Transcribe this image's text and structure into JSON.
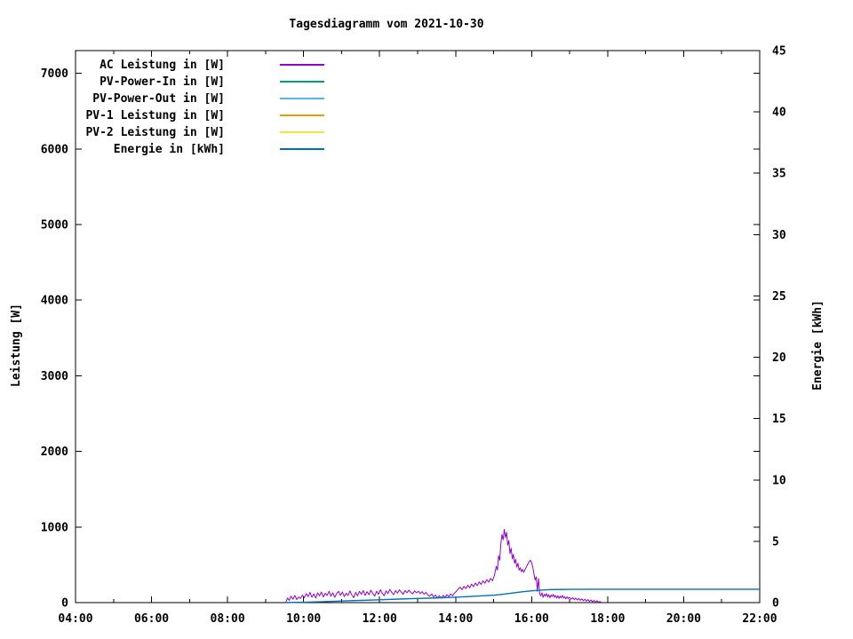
{
  "chart_data": {
    "type": "line",
    "title": "Tagesdiagramm vom 2021-10-30",
    "xlabel": "",
    "ylabel": "Leistung [W]",
    "y2label": "Energie [kWh]",
    "xlim_hours": [
      4,
      22
    ],
    "ylim": [
      0,
      7300
    ],
    "y2lim": [
      0,
      45
    ],
    "grid": false,
    "background": "#ffffff",
    "border_color": "#000000",
    "legend_position": "top-left-inside",
    "x_ticks": [
      {
        "v": 4,
        "label": "04:00"
      },
      {
        "v": 6,
        "label": "06:00"
      },
      {
        "v": 8,
        "label": "08:00"
      },
      {
        "v": 10,
        "label": "10:00"
      },
      {
        "v": 12,
        "label": "12:00"
      },
      {
        "v": 14,
        "label": "14:00"
      },
      {
        "v": 16,
        "label": "16:00"
      },
      {
        "v": 18,
        "label": "18:00"
      },
      {
        "v": 20,
        "label": "20:00"
      },
      {
        "v": 22,
        "label": "22:00"
      }
    ],
    "x_minor_ticks": [
      5,
      7,
      9,
      11,
      13,
      15,
      17,
      19,
      21
    ],
    "y_ticks": [
      {
        "v": 0,
        "label": "0"
      },
      {
        "v": 1000,
        "label": "1000"
      },
      {
        "v": 2000,
        "label": "2000"
      },
      {
        "v": 3000,
        "label": "3000"
      },
      {
        "v": 4000,
        "label": "4000"
      },
      {
        "v": 5000,
        "label": "5000"
      },
      {
        "v": 6000,
        "label": "6000"
      },
      {
        "v": 7000,
        "label": "7000"
      }
    ],
    "y2_ticks": [
      {
        "v": 0,
        "label": "0"
      },
      {
        "v": 5,
        "label": "5"
      },
      {
        "v": 10,
        "label": "10"
      },
      {
        "v": 15,
        "label": "15"
      },
      {
        "v": 20,
        "label": "20"
      },
      {
        "v": 25,
        "label": "25"
      },
      {
        "v": 30,
        "label": "30"
      },
      {
        "v": 35,
        "label": "35"
      },
      {
        "v": 40,
        "label": "40"
      },
      {
        "v": 45,
        "label": "45"
      }
    ],
    "series": [
      {
        "name": "AC Leistung in [W]",
        "color": "#9400d3",
        "axis": "y",
        "width": 1,
        "points": [
          [
            9.53,
            5
          ],
          [
            9.58,
            60
          ],
          [
            9.62,
            30
          ],
          [
            9.67,
            85
          ],
          [
            9.72,
            45
          ],
          [
            9.77,
            95
          ],
          [
            9.82,
            40
          ],
          [
            9.87,
            75
          ],
          [
            9.92,
            55
          ],
          [
            9.97,
            100
          ],
          [
            10.02,
            65
          ],
          [
            10.07,
            120
          ],
          [
            10.12,
            80
          ],
          [
            10.17,
            135
          ],
          [
            10.22,
            70
          ],
          [
            10.27,
            115
          ],
          [
            10.32,
            60
          ],
          [
            10.37,
            130
          ],
          [
            10.42,
            90
          ],
          [
            10.47,
            140
          ],
          [
            10.52,
            75
          ],
          [
            10.57,
            125
          ],
          [
            10.62,
            95
          ],
          [
            10.67,
            150
          ],
          [
            10.72,
            85
          ],
          [
            10.77,
            130
          ],
          [
            10.82,
            70
          ],
          [
            10.87,
            120
          ],
          [
            10.92,
            150
          ],
          [
            10.97,
            95
          ],
          [
            11.02,
            140
          ],
          [
            11.07,
            80
          ],
          [
            11.12,
            125
          ],
          [
            11.17,
            95
          ],
          [
            11.22,
            155
          ],
          [
            11.27,
            100
          ],
          [
            11.32,
            65
          ],
          [
            11.37,
            135
          ],
          [
            11.42,
            90
          ],
          [
            11.47,
            150
          ],
          [
            11.52,
            110
          ],
          [
            11.57,
            160
          ],
          [
            11.62,
            95
          ],
          [
            11.67,
            145
          ],
          [
            11.72,
            105
          ],
          [
            11.77,
            165
          ],
          [
            11.82,
            120
          ],
          [
            11.87,
            85
          ],
          [
            11.92,
            150
          ],
          [
            11.97,
            110
          ],
          [
            12.02,
            170
          ],
          [
            12.07,
            125
          ],
          [
            12.12,
            90
          ],
          [
            12.17,
            155
          ],
          [
            12.22,
            120
          ],
          [
            12.27,
            175
          ],
          [
            12.32,
            135
          ],
          [
            12.37,
            105
          ],
          [
            12.42,
            160
          ],
          [
            12.47,
            125
          ],
          [
            12.52,
            170
          ],
          [
            12.57,
            140
          ],
          [
            12.62,
            110
          ],
          [
            12.67,
            160
          ],
          [
            12.72,
            130
          ],
          [
            12.77,
            165
          ],
          [
            12.82,
            135
          ],
          [
            12.87,
            115
          ],
          [
            12.92,
            155
          ],
          [
            12.97,
            130
          ],
          [
            13.02,
            150
          ],
          [
            13.07,
            120
          ],
          [
            13.12,
            145
          ],
          [
            13.17,
            110
          ],
          [
            13.22,
            135
          ],
          [
            13.27,
            100
          ],
          [
            13.32,
            85
          ],
          [
            13.37,
            115
          ],
          [
            13.42,
            75
          ],
          [
            13.47,
            100
          ],
          [
            13.52,
            65
          ],
          [
            13.57,
            90
          ],
          [
            13.62,
            60
          ],
          [
            13.67,
            95
          ],
          [
            13.72,
            70
          ],
          [
            13.77,
            105
          ],
          [
            13.82,
            80
          ],
          [
            13.87,
            115
          ],
          [
            13.92,
            90
          ],
          [
            13.97,
            125
          ],
          [
            14.02,
            150
          ],
          [
            14.07,
            180
          ],
          [
            14.12,
            205
          ],
          [
            14.17,
            170
          ],
          [
            14.22,
            215
          ],
          [
            14.27,
            185
          ],
          [
            14.32,
            230
          ],
          [
            14.37,
            195
          ],
          [
            14.42,
            245
          ],
          [
            14.47,
            210
          ],
          [
            14.52,
            260
          ],
          [
            14.57,
            225
          ],
          [
            14.62,
            275
          ],
          [
            14.67,
            240
          ],
          [
            14.72,
            290
          ],
          [
            14.77,
            255
          ],
          [
            14.82,
            305
          ],
          [
            14.87,
            270
          ],
          [
            14.92,
            320
          ],
          [
            14.97,
            290
          ],
          [
            15.02,
            360
          ],
          [
            15.07,
            480
          ],
          [
            15.1,
            430
          ],
          [
            15.13,
            620
          ],
          [
            15.16,
            560
          ],
          [
            15.19,
            780
          ],
          [
            15.22,
            900
          ],
          [
            15.25,
            830
          ],
          [
            15.28,
            970
          ],
          [
            15.31,
            860
          ],
          [
            15.34,
            930
          ],
          [
            15.37,
            760
          ],
          [
            15.4,
            820
          ],
          [
            15.43,
            650
          ],
          [
            15.46,
            720
          ],
          [
            15.49,
            580
          ],
          [
            15.52,
            640
          ],
          [
            15.55,
            520
          ],
          [
            15.58,
            570
          ],
          [
            15.61,
            470
          ],
          [
            15.64,
            520
          ],
          [
            15.67,
            430
          ],
          [
            15.7,
            460
          ],
          [
            15.73,
            410
          ],
          [
            15.76,
            440
          ],
          [
            15.79,
            400
          ],
          [
            15.82,
            430
          ],
          [
            15.85,
            460
          ],
          [
            15.88,
            490
          ],
          [
            15.91,
            520
          ],
          [
            15.94,
            545
          ],
          [
            15.97,
            560
          ],
          [
            16.0,
            530
          ],
          [
            16.03,
            470
          ],
          [
            16.06,
            380
          ],
          [
            16.09,
            300
          ],
          [
            16.12,
            340
          ],
          [
            16.15,
            150
          ],
          [
            16.18,
            320
          ],
          [
            16.21,
            120
          ],
          [
            16.24,
            90
          ],
          [
            16.27,
            130
          ],
          [
            16.3,
            70
          ],
          [
            16.33,
            110
          ],
          [
            16.36,
            85
          ],
          [
            16.39,
            120
          ],
          [
            16.42,
            75
          ],
          [
            16.45,
            105
          ],
          [
            16.48,
            65
          ],
          [
            16.51,
            100
          ],
          [
            16.54,
            80
          ],
          [
            16.57,
            110
          ],
          [
            16.6,
            70
          ],
          [
            16.63,
            95
          ],
          [
            16.66,
            60
          ],
          [
            16.69,
            90
          ],
          [
            16.72,
            55
          ],
          [
            16.75,
            85
          ],
          [
            16.78,
            65
          ],
          [
            16.81,
            95
          ],
          [
            16.84,
            60
          ],
          [
            16.87,
            80
          ],
          [
            16.9,
            50
          ],
          [
            16.93,
            75
          ],
          [
            16.96,
            55
          ],
          [
            17.0,
            70
          ],
          [
            17.04,
            45
          ],
          [
            17.08,
            65
          ],
          [
            17.12,
            40
          ],
          [
            17.16,
            60
          ],
          [
            17.2,
            35
          ],
          [
            17.24,
            55
          ],
          [
            17.28,
            30
          ],
          [
            17.32,
            50
          ],
          [
            17.36,
            25
          ],
          [
            17.4,
            45
          ],
          [
            17.44,
            20
          ],
          [
            17.48,
            40
          ],
          [
            17.52,
            15
          ],
          [
            17.56,
            35
          ],
          [
            17.6,
            10
          ],
          [
            17.64,
            30
          ],
          [
            17.68,
            8
          ],
          [
            17.72,
            25
          ],
          [
            17.76,
            5
          ],
          [
            17.8,
            15
          ],
          [
            17.83,
            2
          ]
        ]
      },
      {
        "name": "PV-Power-In in [W]",
        "color": "#009e73",
        "axis": "y",
        "width": 1,
        "points": []
      },
      {
        "name": "PV-Power-Out in [W]",
        "color": "#56b4e9",
        "axis": "y",
        "width": 1,
        "points": []
      },
      {
        "name": "PV-1 Leistung in [W]",
        "color": "#e69f00",
        "axis": "y",
        "width": 1,
        "points": []
      },
      {
        "name": "PV-2 Leistung in [W]",
        "color": "#f0e442",
        "axis": "y",
        "width": 1,
        "points": []
      },
      {
        "name": "Energie in [kWh]",
        "color": "#0072b2",
        "axis": "y2",
        "width": 1.4,
        "points": [
          [
            9.5,
            0.0
          ],
          [
            10.0,
            0.03
          ],
          [
            10.5,
            0.08
          ],
          [
            11.0,
            0.13
          ],
          [
            11.5,
            0.18
          ],
          [
            12.0,
            0.23
          ],
          [
            12.5,
            0.29
          ],
          [
            13.0,
            0.34
          ],
          [
            13.5,
            0.38
          ],
          [
            14.0,
            0.44
          ],
          [
            14.5,
            0.52
          ],
          [
            15.0,
            0.6
          ],
          [
            15.25,
            0.68
          ],
          [
            15.5,
            0.78
          ],
          [
            15.75,
            0.88
          ],
          [
            16.0,
            0.96
          ],
          [
            16.25,
            1.02
          ],
          [
            16.5,
            1.06
          ],
          [
            17.0,
            1.08
          ],
          [
            17.5,
            1.09
          ],
          [
            18.0,
            1.09
          ],
          [
            22.0,
            1.09
          ]
        ]
      }
    ]
  }
}
